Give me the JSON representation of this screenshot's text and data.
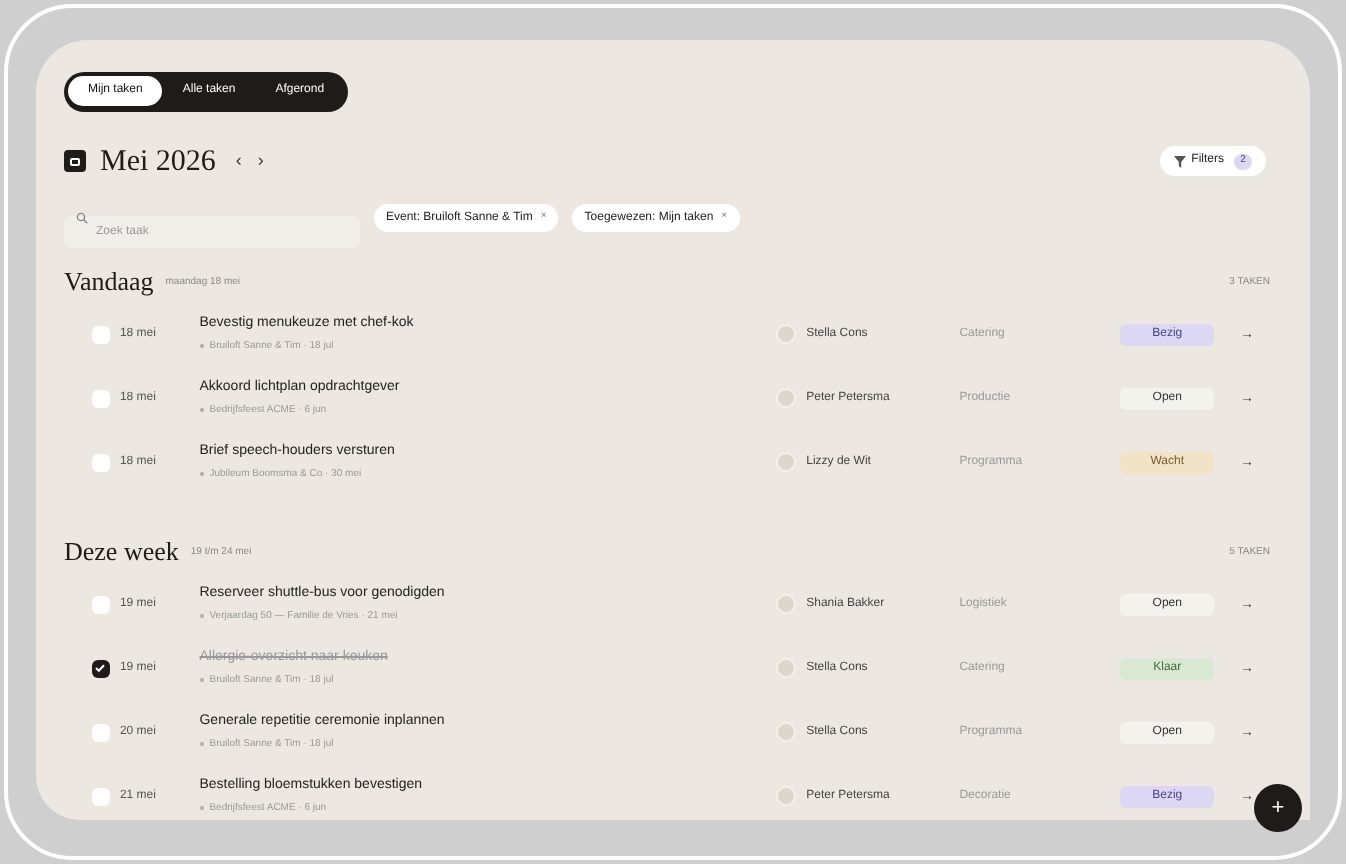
{
  "tabs": [
    {
      "label": "Mijn taken",
      "selected": true
    },
    {
      "label": "Alle taken",
      "selected": false
    },
    {
      "label": "Afgerond",
      "selected": false
    }
  ],
  "month": {
    "title": "Mei 2026",
    "prev": "‹",
    "next": "›"
  },
  "filters_button": {
    "label": "Filters",
    "count": "2"
  },
  "search": {
    "placeholder": "Zoek taak"
  },
  "chips": [
    {
      "label": "Event: Bruiloft Sanne & Tim",
      "remove": "×"
    },
    {
      "label": "Toegewezen: Mijn taken",
      "remove": "×"
    }
  ],
  "sections": [
    {
      "title": "Vandaag",
      "subtitle": "maandag 18 mei",
      "count": "3 TAKEN",
      "tasks": [
        {
          "date": "18 mei",
          "title": "Bevestig menukeuze met chef-kok",
          "event": "Bruiloft Sanne & Tim · 18 jul",
          "assignee": "Stella Cons",
          "category": "Catering",
          "status": "Bezig",
          "color": "#dcd8f3",
          "checked": false,
          "arrow": "→"
        },
        {
          "date": "18 mei",
          "title": "Akkoord lichtplan opdrachtgever",
          "event": "Bedrijfsfeest ACME · 6 jun",
          "assignee": "Peter Petersma",
          "category": "Productie",
          "status": "Open",
          "color": "#f4f2ed",
          "checked": false,
          "arrow": "→"
        },
        {
          "date": "18 mei",
          "title": "Brief speech-houders versturen",
          "event": "Jubileum Boomsma & Co · 30 mei",
          "assignee": "Lizzy de Wit",
          "category": "Programma",
          "status": "Wacht",
          "color": "#f3e3c6",
          "checked": false,
          "arrow": "→"
        }
      ]
    },
    {
      "title": "Deze week",
      "subtitle": "19 t/m 24 mei",
      "count": "5 TAKEN",
      "tasks": [
        {
          "date": "19 mei",
          "title": "Reserveer shuttle-bus voor genodigden",
          "event": "Verjaardag 50 — Familie de Vries · 21 mei",
          "assignee": "Shania Bakker",
          "category": "Logistiek",
          "status": "Open",
          "color": "#f4f2ed",
          "checked": false,
          "arrow": "→"
        },
        {
          "date": "19 mei",
          "title": "Allergie-overzicht naar keuken",
          "event": "Bruiloft Sanne & Tim · 18 jul",
          "assignee": "Stella Cons",
          "category": "Catering",
          "status": "Klaar",
          "color": "#d9e8d3",
          "checked": true,
          "arrow": "→"
        },
        {
          "date": "20 mei",
          "title": "Generale repetitie ceremonie inplannen",
          "event": "Bruiloft Sanne & Tim · 18 jul",
          "assignee": "Stella Cons",
          "category": "Programma",
          "status": "Open",
          "color": "#f4f2ed",
          "checked": false,
          "arrow": "→"
        },
        {
          "date": "21 mei",
          "title": "Bestelling bloemstukken bevestigen",
          "event": "Bedrijfsfeest ACME · 6 jun",
          "assignee": "Peter Petersma",
          "category": "Decoratie",
          "status": "Bezig",
          "color": "#dcd8f3",
          "checked": false,
          "arrow": "→"
        }
      ]
    }
  ],
  "add_button": {
    "label": "+"
  }
}
